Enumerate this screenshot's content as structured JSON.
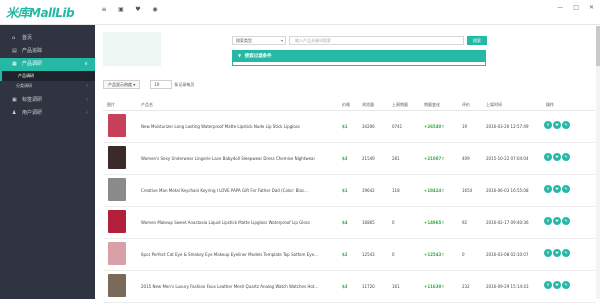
{
  "app": {
    "logo": "米库MallLib"
  },
  "top_icons": [
    "≡",
    "▣",
    "♥",
    "◉"
  ],
  "window_controls": [
    "—",
    "□",
    "✕"
  ],
  "sidebar": {
    "items": [
      {
        "icon": "⌂",
        "label": "首页",
        "active": false,
        "arrow": ""
      },
      {
        "icon": "▤",
        "label": "产品追踪",
        "active": false,
        "arrow": ""
      },
      {
        "icon": "▦",
        "label": "产品调研",
        "active": true,
        "arrow": "∨"
      }
    ],
    "subitems": [
      {
        "label": "产品调研",
        "current": true,
        "arrow": ""
      },
      {
        "label": "分类调研",
        "current": false,
        "arrow": "‹"
      }
    ],
    "items2": [
      {
        "icon": "▣",
        "label": "标签调研",
        "arrow": "‹"
      },
      {
        "icon": "♟",
        "label": "用户调研",
        "arrow": "‹"
      }
    ]
  },
  "search": {
    "type_placeholder": "搜索类型",
    "input_placeholder": "输入产品关键词搜索",
    "button": "搜索"
  },
  "advanced": {
    "label": "搜索过滤条件"
  },
  "controls": {
    "sort_label": "产品显示热度 ▾",
    "per_page": "10",
    "per_page_label": "条记录每页"
  },
  "table": {
    "headers": [
      "图片",
      "产品名",
      "价格",
      "浏览量",
      "上周销量",
      "销量变化",
      "评价",
      "上架时间",
      "操作"
    ],
    "rows": [
      {
        "name": "New Moisturizer Long Lasting Waterproof Matte Lipstick Nude Lip Stick Lipgloss",
        "price": "$1",
        "views": "34206",
        "sales": "0741",
        "delta": "+26540↑",
        "rating": "19",
        "date": "2016-03-20 12:57:49",
        "thumb": "#c8415a"
      },
      {
        "name": "Women's Sexy Underwear Lingerie Lace Babydoll Sleepwear Dress Chemise Nightwear",
        "price": "$3",
        "views": "21549",
        "sales": "281",
        "delta": "+21087↑",
        "rating": "409",
        "date": "2015-10-22 07:04:04",
        "thumb": "#3a2a2a"
      },
      {
        "name": "Creative Man Metal Keychain Keyring I LOVE PAPA Gift For Father Dad (Color: Blac...",
        "price": "$1",
        "views": "19642",
        "sales": "118",
        "delta": "+18424↑",
        "rating": "1654",
        "date": "2016-06-03 16:55:08",
        "thumb": "#8a8a8a"
      },
      {
        "name": "Women Makeup Sweet Anastasia Liquid Lipstick Matte Lipgloss Waterproof Lip Gloss",
        "price": "$4",
        "views": "16865",
        "sales": "0",
        "delta": "+14965↑",
        "rating": "92",
        "date": "2016-02-17 09:40:36",
        "thumb": "#b2203c"
      },
      {
        "name": "6pcs Perfect Cat Eye & Smokey Eye Makeup Eyeliner Models Template Top Sotfom Eye...",
        "price": "$2",
        "views": "12543",
        "sales": "0",
        "delta": "+12543↑",
        "rating": "0",
        "date": "2016-03-08 02:10:07",
        "thumb": "#d9a0a8"
      },
      {
        "name": "2015 New Men's Luxury Fashion Faux Leather Mesh Quartz Analog Watch Watches Hot...",
        "price": "$3",
        "views": "11720",
        "sales": "161",
        "delta": "+11639↑",
        "rating": "232",
        "date": "2016-09-29 15:14:43",
        "thumb": "#7a6a5a"
      }
    ]
  },
  "actions": [
    "⚲",
    "✚",
    "✎"
  ],
  "colors": {
    "accent": "#25b8a5",
    "sidebar": "#2f3440",
    "positive": "#3aa84a"
  }
}
